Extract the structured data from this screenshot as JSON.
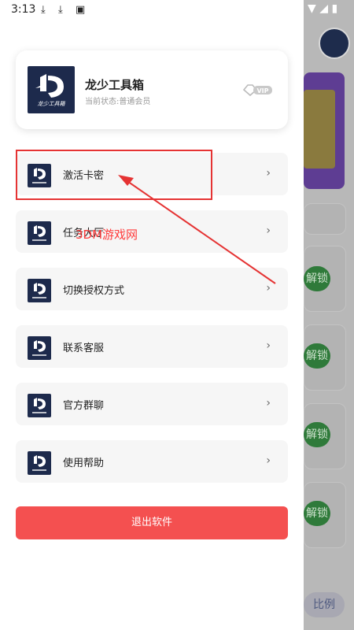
{
  "status_bar": {
    "time": "3:13"
  },
  "profile": {
    "app_name": "龙少工具箱",
    "status": "当前状态:普通会员",
    "badge": "VIP"
  },
  "logo": {
    "text": "龙少工具箱"
  },
  "menu": [
    {
      "label": "激活卡密"
    },
    {
      "label": "任务大厅"
    },
    {
      "label": "切换授权方式"
    },
    {
      "label": "联系客服"
    },
    {
      "label": "官方群聊"
    },
    {
      "label": "使用帮助"
    }
  ],
  "logout_label": "退出软件",
  "watermark": "3DM游戏网",
  "background": {
    "pill_text": "解锁",
    "ratio_text": "比例"
  },
  "colors": {
    "logout": "#f45050",
    "logo_bg": "#1d2a4c",
    "annotation": "#e53333"
  }
}
